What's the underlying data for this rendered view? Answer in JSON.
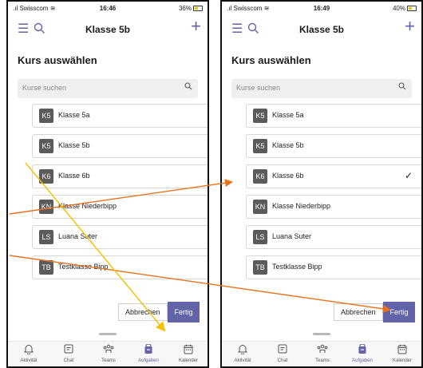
{
  "status": {
    "carrier": "Swisscom",
    "left_time": "16:46",
    "left_battery": "36%",
    "right_time": "16:49",
    "right_battery": "40%"
  },
  "header": {
    "title": "Klasse 5b"
  },
  "sheet": {
    "title": "Kurs auswählen",
    "search_placeholder": "Kurse suchen",
    "cancel_label": "Abbrechen",
    "done_label": "Fertig"
  },
  "courses": [
    {
      "initials": "K5",
      "label": "Klasse 5a"
    },
    {
      "initials": "K5",
      "label": "Klasse 5b"
    },
    {
      "initials": "K6",
      "label": "Klasse 6b",
      "selected_right": true
    },
    {
      "initials": "KN",
      "label": "Klasse Niederbipp"
    },
    {
      "initials": "LS",
      "label": "Luana Suter"
    },
    {
      "initials": "TB",
      "label": "Testklasse Bipp"
    }
  ],
  "tabs": [
    {
      "icon": "bell-icon",
      "label": "Aktivität"
    },
    {
      "icon": "chat-icon",
      "label": "Chat"
    },
    {
      "icon": "teams-icon",
      "label": "Teams"
    },
    {
      "icon": "assignments-icon",
      "label": "Aufgaben",
      "active": true
    },
    {
      "icon": "calendar-icon",
      "label": "Kalender"
    }
  ],
  "colors": {
    "accent": "#6264a7",
    "arrow_orange": "#e8731e",
    "arrow_yellow": "#f2c200"
  }
}
